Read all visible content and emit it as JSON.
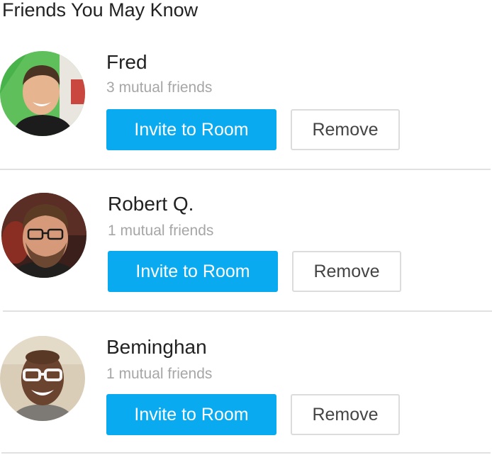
{
  "section": {
    "title": "Friends You May Know"
  },
  "friends": [
    {
      "name": "Fred",
      "mutual": "3 mutual friends",
      "invite_label": "Invite to Room",
      "remove_label": "Remove"
    },
    {
      "name": "Robert Q.",
      "mutual": "1 mutual friends",
      "invite_label": "Invite to Room",
      "remove_label": "Remove"
    },
    {
      "name": "Beminghan",
      "mutual": "1 mutual friends",
      "invite_label": "Invite to Room",
      "remove_label": "Remove"
    }
  ],
  "colors": {
    "accent": "#0aaaf0",
    "muted_text": "#a6a6a6",
    "divider": "#e1e1e1",
    "button_border": "#dcdcdc"
  }
}
